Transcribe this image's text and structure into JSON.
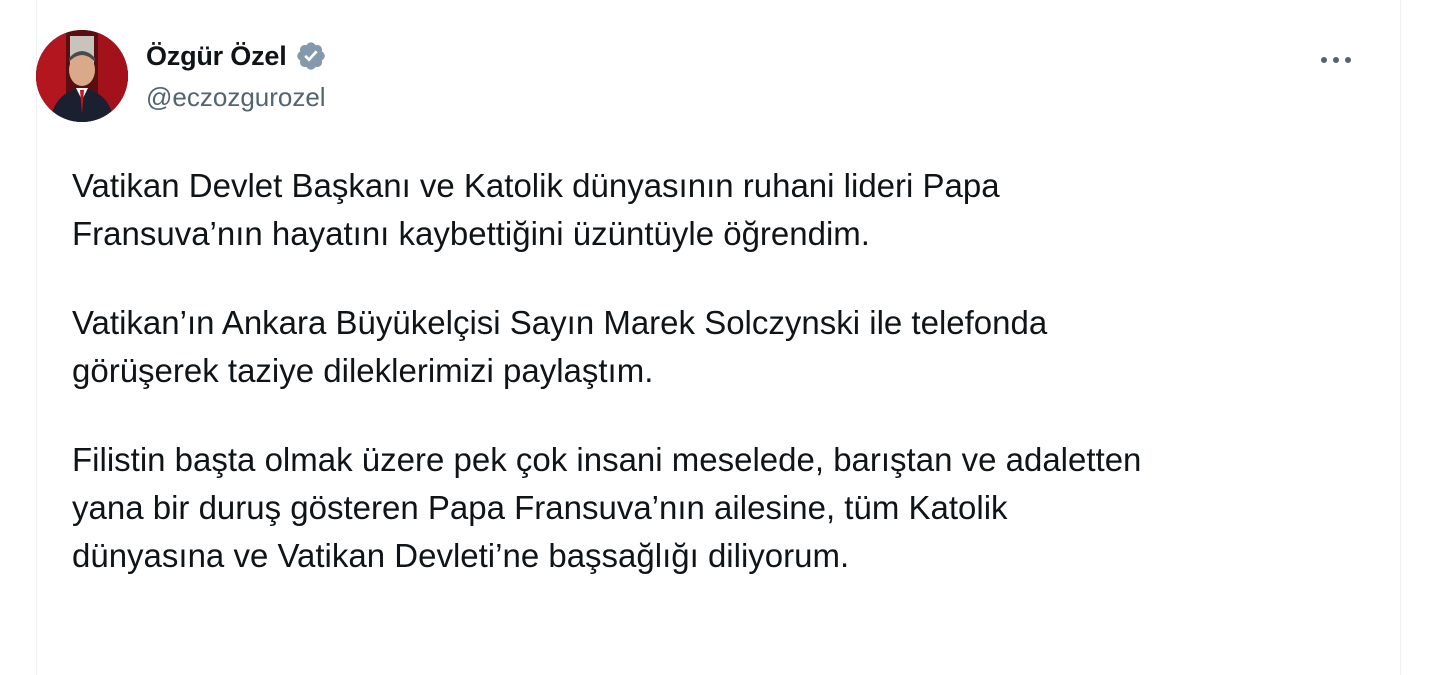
{
  "tweet": {
    "author": {
      "display_name": "Özgür Özel",
      "handle": "@eczozgurozel",
      "verified": true
    },
    "colors": {
      "verified_badge": "#829aab",
      "text": "#0f1419",
      "secondary": "#536471",
      "avatar_background": "#7a1016"
    },
    "paragraphs": [
      "Vatikan Devlet Başkanı ve Katolik dünyasının ruhani lideri Papa\nFransuva’nın hayatını kaybettiğini üzüntüyle öğrendim.",
      "Vatikan’ın Ankara Büyükelçisi Sayın Marek Solczynski ile telefonda\ngörüşerek taziye dileklerimizi paylaştım.",
      "Filistin başta olmak üzere pek çok insani meselede, barıştan ve adaletten\nyana bir duruş gösteren Papa Fransuva’nın ailesine, tüm Katolik\ndünyasına ve Vatikan Devleti’ne başsağlığı diliyorum."
    ],
    "icons": {
      "verified": "verified-badge-icon",
      "more": "more-horizontal-icon"
    }
  }
}
